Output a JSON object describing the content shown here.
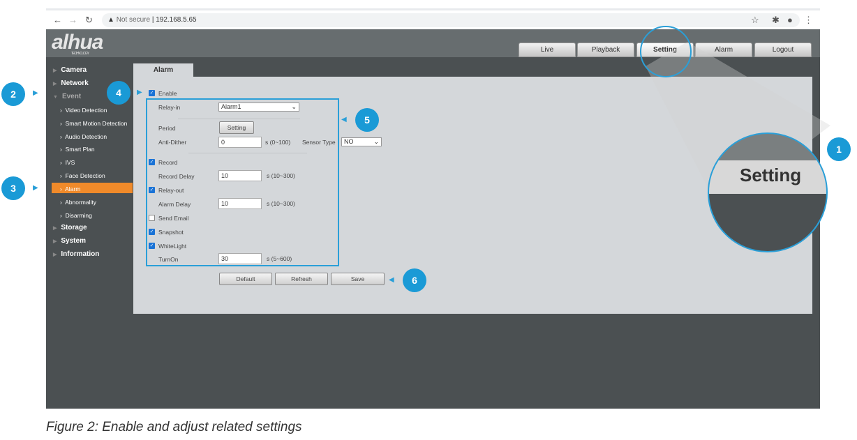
{
  "browser": {
    "security": "Not secure",
    "url": "192.168.5.65"
  },
  "logo": {
    "brand": "alhua",
    "sub": "TECHNOLOGY"
  },
  "nav_tabs": [
    "Live",
    "Playback",
    "Setting",
    "Alarm",
    "Logout"
  ],
  "sidebar": {
    "top": [
      "Camera",
      "Network",
      "Event"
    ],
    "event_items": [
      "Video Detection",
      "Smart Motion Detection",
      "Audio Detection",
      "Smart Plan",
      "IVS",
      "Face Detection",
      "Alarm",
      "Abnormality",
      "Disarming"
    ],
    "bottom": [
      "Storage",
      "System",
      "Information"
    ]
  },
  "tab": "Alarm",
  "form": {
    "enable": "Enable",
    "relay_in_label": "Relay-in",
    "relay_in_value": "Alarm1",
    "period_label": "Period",
    "period_button": "Setting",
    "anti_dither_label": "Anti-Dither",
    "anti_dither_value": "0",
    "anti_dither_range": "s (0~100)",
    "sensor_type_label": "Sensor Type",
    "sensor_type_value": "NO",
    "record": "Record",
    "record_delay_label": "Record Delay",
    "record_delay_value": "10",
    "record_delay_range": "s (10~300)",
    "relay_out": "Relay-out",
    "alarm_delay_label": "Alarm Delay",
    "alarm_delay_value": "10",
    "alarm_delay_range": "s (10~300)",
    "send_email": "Send Email",
    "snapshot": "Snapshot",
    "whitelight": "WhiteLight",
    "turnon_label": "TurnOn",
    "turnon_value": "30",
    "turnon_range": "s (5~600)"
  },
  "buttons": {
    "default": "Default",
    "refresh": "Refresh",
    "save": "Save"
  },
  "magnifier": "Setting",
  "callouts": [
    "1",
    "2",
    "3",
    "4",
    "5",
    "6"
  ],
  "caption": "Figure 2: Enable and adjust related settings"
}
